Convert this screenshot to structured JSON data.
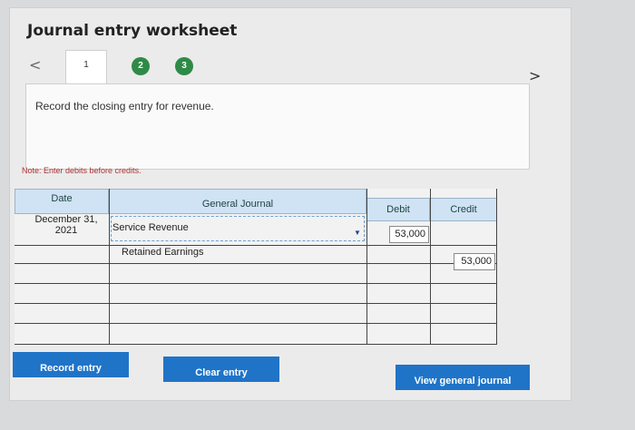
{
  "title": "Journal entry worksheet",
  "nav": {
    "prev_label": "<",
    "next_label": ">",
    "steps": [
      {
        "label": "1"
      },
      {
        "label": "2"
      },
      {
        "label": "3"
      }
    ]
  },
  "instruction": "Record the closing entry for revenue.",
  "note": "Note: Enter debits before credits.",
  "table": {
    "headers": {
      "date": "Date",
      "journal": "General Journal",
      "debit": "Debit",
      "credit": "Credit"
    },
    "rows": [
      {
        "date": "December 31,\n2021",
        "account": "Service Revenue",
        "debit": "53,000",
        "credit": ""
      },
      {
        "date": "",
        "account": "Retained Earnings",
        "debit": "",
        "credit": "53,000"
      }
    ]
  },
  "buttons": {
    "record": "Record entry",
    "clear": "Clear entry",
    "view": "View general journal"
  },
  "colors": {
    "accent": "#1f74c8",
    "step_complete": "#2e8a47",
    "header_bg": "#cfe3f5",
    "note": "#aa3333"
  }
}
